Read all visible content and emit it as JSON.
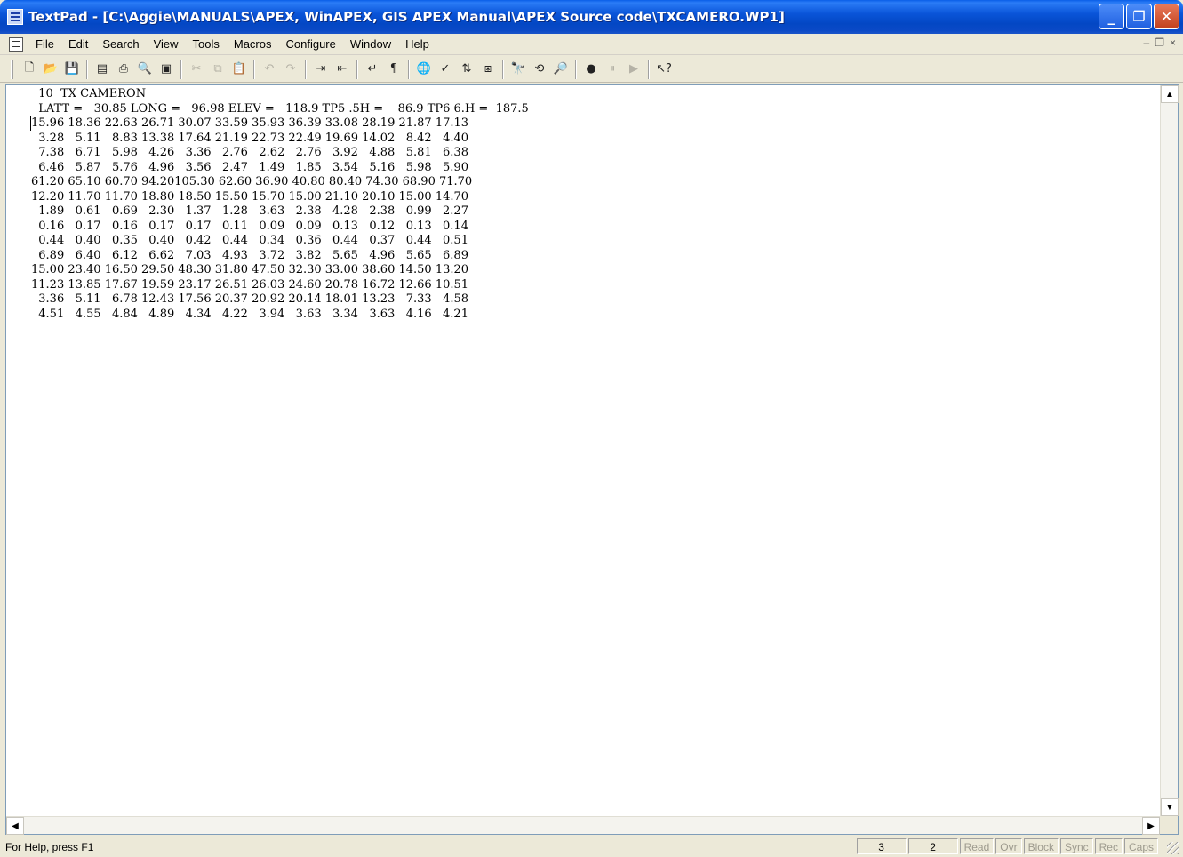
{
  "window": {
    "title": "TextPad - [C:\\Aggie\\MANUALS\\APEX, WinAPEX, GIS APEX Manual\\APEX Source code\\TXCAMERO.WP1]",
    "buttons": {
      "minimize": "_",
      "maximize": "❐",
      "close": "✕"
    }
  },
  "menu": [
    "File",
    "Edit",
    "Search",
    "View",
    "Tools",
    "Macros",
    "Configure",
    "Window",
    "Help"
  ],
  "mdi_buttons": {
    "minimize": "–",
    "restore": "❐",
    "close": "×"
  },
  "toolbar": {
    "icons": [
      {
        "name": "new-file-icon",
        "glyph": "🗋"
      },
      {
        "name": "open-file-icon",
        "glyph": "📂"
      },
      {
        "name": "save-icon",
        "glyph": "💾"
      },
      {
        "name": "sep"
      },
      {
        "name": "save-all-icon",
        "glyph": "▤"
      },
      {
        "name": "print-icon",
        "glyph": "⎙"
      },
      {
        "name": "print-preview-icon",
        "glyph": "🔍"
      },
      {
        "name": "page-setup-icon",
        "glyph": "▣"
      },
      {
        "name": "sep"
      },
      {
        "name": "cut-icon",
        "glyph": "✂",
        "dim": true
      },
      {
        "name": "copy-icon",
        "glyph": "⧉",
        "dim": true
      },
      {
        "name": "paste-icon",
        "glyph": "📋",
        "dim": true
      },
      {
        "name": "sep"
      },
      {
        "name": "undo-icon",
        "glyph": "↶",
        "dim": true
      },
      {
        "name": "redo-icon",
        "glyph": "↷",
        "dim": true
      },
      {
        "name": "sep"
      },
      {
        "name": "indent-icon",
        "glyph": "⇥"
      },
      {
        "name": "outdent-icon",
        "glyph": "⇤"
      },
      {
        "name": "sep"
      },
      {
        "name": "word-wrap-icon",
        "glyph": "↵"
      },
      {
        "name": "visible-spaces-icon",
        "glyph": "¶"
      },
      {
        "name": "sep"
      },
      {
        "name": "web-browser-icon",
        "glyph": "🌐"
      },
      {
        "name": "spelling-icon",
        "glyph": "✓"
      },
      {
        "name": "sort-icon",
        "glyph": "⇅"
      },
      {
        "name": "compare-icon",
        "glyph": "⧆"
      },
      {
        "name": "sep"
      },
      {
        "name": "find-icon",
        "glyph": "🔭"
      },
      {
        "name": "replace-icon",
        "glyph": "⟲"
      },
      {
        "name": "find-in-files-icon",
        "glyph": "🔎"
      },
      {
        "name": "sep"
      },
      {
        "name": "record-macro-icon",
        "glyph": "●"
      },
      {
        "name": "pause-macro-icon",
        "glyph": "⏸",
        "dim": true
      },
      {
        "name": "play-macro-icon",
        "glyph": "▶",
        "dim": true
      },
      {
        "name": "sep"
      },
      {
        "name": "context-help-icon",
        "glyph": "↖?"
      }
    ]
  },
  "editor": {
    "lines": [
      "  10  TX CAMERON",
      "  LATT =   30.85 LONG =   96.98 ELEV =   118.9 TP5 .5H =    86.9 TP6 6.H =  187.5",
      "15.96 18.36 22.63 26.71 30.07 33.59 35.93 36.39 33.08 28.19 21.87 17.13",
      "  3.28   5.11   8.83 13.38 17.64 21.19 22.73 22.49 19.69 14.02   8.42   4.40",
      "  7.38   6.71   5.98   4.26   3.36   2.76   2.62   2.76   3.92   4.88   5.81   6.38",
      "  6.46   5.87   5.76   4.96   3.56   2.47   1.49   1.85   3.54   5.16   5.98   5.90",
      "61.20 65.10 60.70 94.20105.30 62.60 36.90 40.80 80.40 74.30 68.90 71.70",
      "12.20 11.70 11.70 18.80 18.50 15.50 15.70 15.00 21.10 20.10 15.00 14.70",
      "  1.89   0.61   0.69   2.30   1.37   1.28   3.63   2.38   4.28   2.38   0.99   2.27",
      "  0.16   0.17   0.16   0.17   0.17   0.11   0.09   0.09   0.13   0.12   0.13   0.14",
      "  0.44   0.40   0.35   0.40   0.42   0.44   0.34   0.36   0.44   0.37   0.44   0.51",
      "  6.89   6.40   6.12   6.62   7.03   4.93   3.72   3.82   5.65   4.96   5.65   6.89",
      "15.00 23.40 16.50 29.50 48.30 31.80 47.50 32.30 33.00 38.60 14.50 13.20",
      "11.23 13.85 17.67 19.59 23.17 26.51 26.03 24.60 20.78 16.72 12.66 10.51",
      "  3.36   5.11   6.78 12.43 17.56 20.37 20.92 20.14 18.01 13.23   7.33   4.58",
      "  4.51   4.55   4.84   4.89   4.34   4.22   3.94   3.63   3.34   3.63   4.16   4.21"
    ]
  },
  "scrollbar": {
    "up": "▲",
    "down": "▼",
    "left": "◀",
    "right": "▶"
  },
  "status": {
    "help_text": "For Help, press F1",
    "line": "3",
    "column": "2",
    "flags": [
      "Read",
      "Ovr",
      "Block",
      "Sync",
      "Rec",
      "Caps"
    ]
  }
}
